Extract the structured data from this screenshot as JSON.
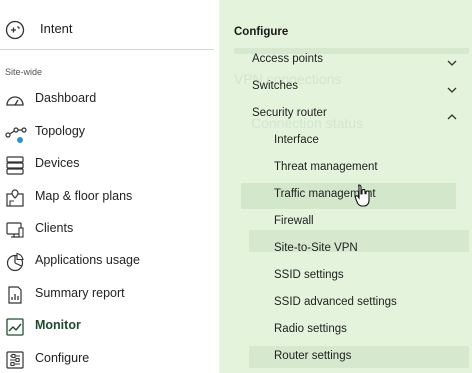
{
  "sidebar": {
    "intent_label": "Intent",
    "section_label": "Site-wide",
    "items": [
      {
        "label": "Dashboard",
        "icon": "gauge-icon"
      },
      {
        "label": "Topology",
        "icon": "topology-icon"
      },
      {
        "label": "Devices",
        "icon": "server-icon"
      },
      {
        "label": "Map & floor plans",
        "icon": "map-pin-icon"
      },
      {
        "label": "Clients",
        "icon": "monitor-icon"
      },
      {
        "label": "Applications usage",
        "icon": "pie-chart-icon"
      },
      {
        "label": "Summary report",
        "icon": "report-icon"
      },
      {
        "label": "Monitor",
        "icon": "line-chart-icon",
        "active": true
      },
      {
        "label": "Configure",
        "icon": "sliders-icon"
      }
    ]
  },
  "flyout": {
    "title": "Configure",
    "groups": [
      {
        "label": "Access points",
        "expanded": false
      },
      {
        "label": "Switches",
        "expanded": false
      },
      {
        "label": "Security router",
        "expanded": true
      }
    ],
    "security_router_items": [
      "Interface",
      "Threat management",
      "Traffic management",
      "Firewall",
      "Site-to-Site VPN",
      "SSID settings",
      "SSID advanced settings",
      "Radio settings",
      "Router settings"
    ],
    "hovered_item": "Traffic management"
  },
  "background": {
    "page_heading": "VPN connections",
    "panel_heading": "Connection status"
  },
  "colors": {
    "flyout_bg": "#e3f3dc",
    "hover_bg": "#d3e8cb",
    "active_text": "#1f4d2c"
  }
}
